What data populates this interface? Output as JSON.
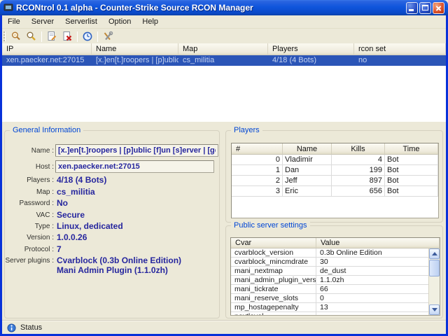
{
  "window": {
    "title": "RCONtrol 0.1 alpha - Counter-Strike Source RCON Manager"
  },
  "menu": {
    "items": [
      "File",
      "Server",
      "Serverlist",
      "Option",
      "Help"
    ]
  },
  "toolbar": {
    "icons": [
      "connect",
      "search",
      "add-server",
      "remove-server",
      "refresh",
      "settings"
    ]
  },
  "server_list": {
    "columns": [
      "IP",
      "Name",
      "Map",
      "Players",
      "rcon set"
    ],
    "selected_row": {
      "ip": "xen.paecker.net:27015",
      "name": "[x.]en[t.]roopers | [p]ublic [f]...",
      "map": "cs_militia",
      "players": "4/18 (4 Bots)",
      "rcon_set": "no"
    }
  },
  "general_info": {
    "title": "General Information",
    "name_label": "Name :",
    "name_value": "[x.]en[t.]roopers | [p]ublic [f]un [s]erver | [ge",
    "host_label": "Host :",
    "host_value": "xen.paecker.net:27015",
    "players_label": "Players :",
    "players_value": "4/18 (4 Bots)",
    "map_label": "Map :",
    "map_value": "cs_militia",
    "password_label": "Password :",
    "password_value": "No",
    "vac_label": "VAC :",
    "vac_value": "Secure",
    "type_label": "Type :",
    "type_value": "Linux, dedicated",
    "version_label": "Version :",
    "version_value": "1.0.0.26",
    "protocol_label": "Protocol :",
    "protocol_value": "7",
    "plugins_label": "Server plugins :",
    "plugins_line1": "Cvarblock (0.3b Online Edition)",
    "plugins_line2": "Mani Admin Plugin (1.1.0zh)"
  },
  "players_panel": {
    "title": "Players",
    "columns": [
      "#",
      "Name",
      "Kills",
      "Time"
    ],
    "rows": [
      [
        "0",
        "Vladimir",
        "4",
        "Bot"
      ],
      [
        "1",
        "Dan",
        "199",
        "Bot"
      ],
      [
        "2",
        "Jeff",
        "897",
        "Bot"
      ],
      [
        "3",
        "Eric",
        "656",
        "Bot"
      ]
    ]
  },
  "settings_panel": {
    "title": "Public server settings",
    "columns": [
      "Cvar",
      "Value"
    ],
    "rows": [
      [
        "cvarblock_version",
        "0.3b Online Edition"
      ],
      [
        "cvarblock_mincmdrate",
        "30"
      ],
      [
        "mani_nextmap",
        "de_dust"
      ],
      [
        "mani_admin_plugin_version",
        "1.1.0zh"
      ],
      [
        "mani_tickrate",
        "66"
      ],
      [
        "mani_reserve_slots",
        "0"
      ],
      [
        "mp_hostagepenalty",
        "13"
      ],
      [
        "nextlevel",
        ""
      ]
    ]
  },
  "status_bar": {
    "text": "Status"
  },
  "colors": {
    "titlebar_blue": "#0F55DC",
    "window_border": "#0831D9",
    "selection_blue": "#2B55B7",
    "value_navy": "#26269E",
    "group_label_blue": "#0046D5",
    "background_beige": "#ECE9D8"
  }
}
